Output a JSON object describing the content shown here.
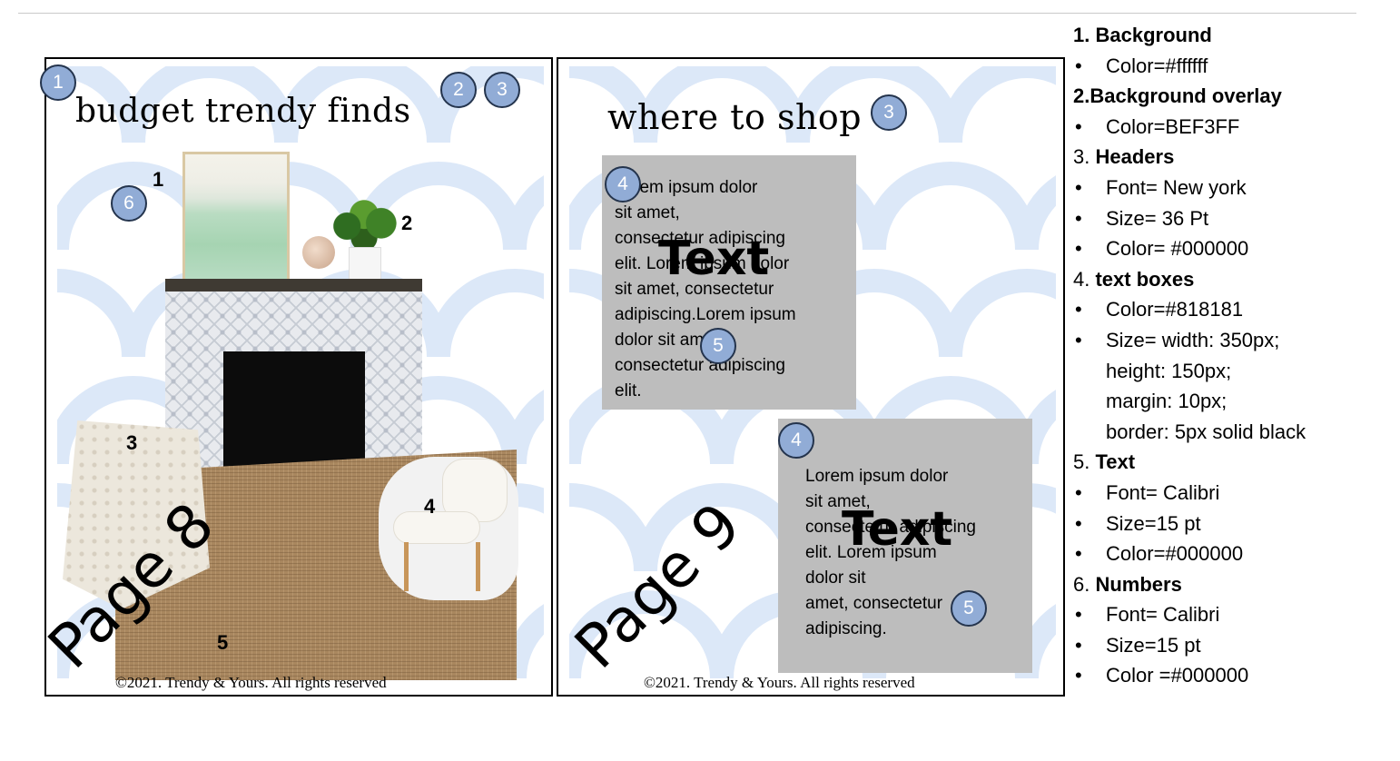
{
  "page8": {
    "header": "budget trendy finds",
    "product_numbers": [
      "1",
      "2",
      "3",
      "4",
      "5"
    ],
    "watermark": "Page 8",
    "footer": "©2021. Trendy & Yours. All rights reserved"
  },
  "page9": {
    "header": "where to shop",
    "text_boxes": [
      {
        "text": "Lorem ipsum dolor\nsit amet,\nconsectetur adipiscing\nelit.  Lorem ipsum dolor\nsit amet, consectetur\nadipiscing.Lorem ipsum\ndolor sit amet,\nconsectetur adipiscing\nelit.",
        "overlay": "Text"
      },
      {
        "text": "Lorem ipsum dolor\nsit amet,\nconsectetur adipiscing\nelit.  Lorem ipsum\ndolor sit\namet, consectetur\nadipiscing.",
        "overlay": "Text"
      }
    ],
    "watermark": "Page 9",
    "footer": "©2021. Trendy & Yours. All rights reserved"
  },
  "markers": [
    "1",
    "2",
    "3",
    "6",
    "3",
    "4",
    "5",
    "4",
    "5"
  ],
  "legend": [
    {
      "num": "1.",
      "title": "Background",
      "items": [
        "Color=#ffffff"
      ]
    },
    {
      "num": "2.",
      "title": "Background overlay",
      "items": [
        "Color=BEF3FF"
      ]
    },
    {
      "num": "3.",
      "title": "Headers",
      "items": [
        "Font= New york",
        "Size= 36 Pt",
        "Color= #000000"
      ]
    },
    {
      "num": "4.",
      "title": "text boxes",
      "items": [
        "Color=#818181",
        "Size= width: 350px;\n  height: 150px;\n  margin: 10px;\n  border: 5px solid black"
      ]
    },
    {
      "num": "5.",
      "title": "Text",
      "items": [
        "Font= Calibri",
        "Size=15 pt",
        "Color=#000000"
      ]
    },
    {
      "num": "6.",
      "title": "Numbers",
      "items": [
        "Font= Calibri",
        "Size=15 pt",
        "Color =#000000"
      ]
    }
  ],
  "colors": {
    "background": "#ffffff",
    "pattern": "#dce8f8",
    "marker": "#91acd6",
    "text_box": "#bdbdbd"
  }
}
